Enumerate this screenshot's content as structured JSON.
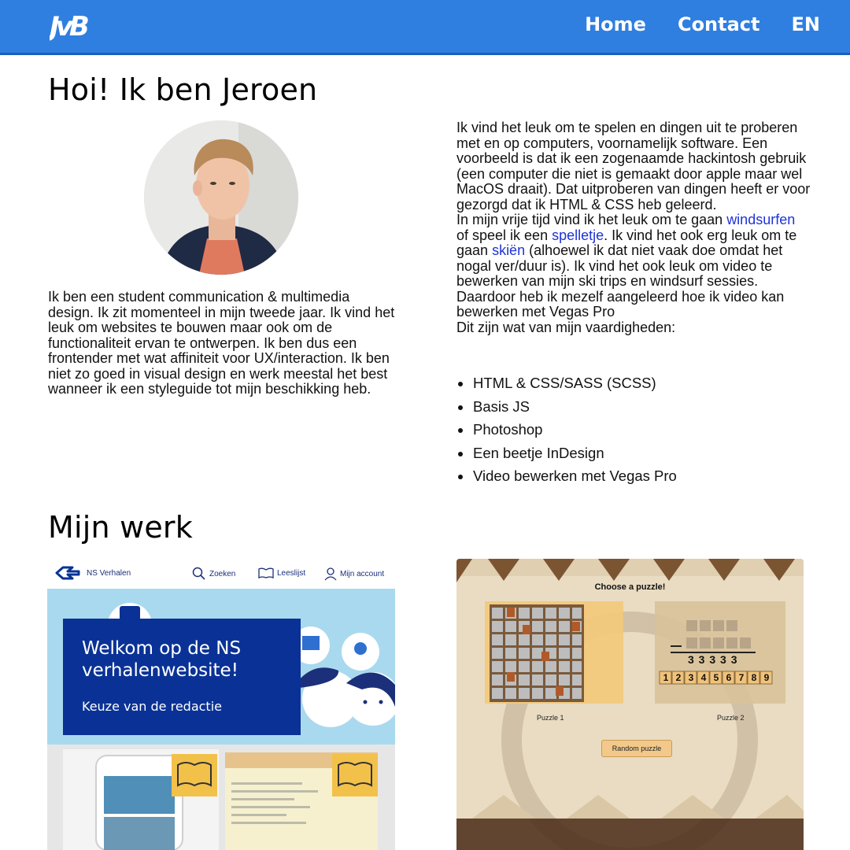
{
  "header": {
    "logo": "JvB",
    "nav": [
      "Home",
      "Contact",
      "EN"
    ]
  },
  "intro": {
    "title": "Hoi! Ik ben Jeroen",
    "left_text": "Ik ben een student communication & multimedia design. Ik zit momenteel in mijn tweede jaar. Ik vind het leuk om websites te bouwen maar ook om de functionaliteit ervan te ontwerpen. Ik ben dus een frontender met wat affiniteit voor UX/interaction. Ik ben niet zo goed in visual design en werk meestal het best wanneer ik een styleguide tot mijn beschikking heb.",
    "right_p1": "Ik vind het leuk om te spelen en dingen uit te proberen met en op computers, voornamelijk software. Een voorbeeld is dat ik een zogenaamde hackintosh gebruik (een computer die niet is gemaakt door apple maar wel MacOS draait). Dat uitproberen van dingen heeft er voor gezorgd dat ik HTML & CSS heb geleerd.",
    "right_p2_a": "In mijn vrije tijd vind ik het leuk om te gaan",
    "link_windsurfen": "windsurfen",
    "right_p2_b": "of speel ik een",
    "link_spelletje": "spelletje",
    "right_p2_c": ". Ik vind het ook erg leuk om te gaan",
    "link_skien": "skiën",
    "right_p2_d": "(alhoewel ik dat niet vaak doe omdat het nogal ver/duur is). Ik vind het ook leuk om video te bewerken van mijn ski trips en windsurf sessies. Daardoor heb ik mezelf aangeleerd hoe ik video kan bewerken met Vegas Pro",
    "skills_intro": "Dit zijn wat van mijn vaardigheden:",
    "skills": [
      "HTML & CSS/SASS (SCSS)",
      "Basis JS",
      "Photoshop",
      "Een beetje InDesign",
      "Video bewerken met Vegas Pro"
    ]
  },
  "work": {
    "title": "Mijn werk",
    "ns": {
      "site_name": "NS Verhalen",
      "menu": [
        "Zoeken",
        "Leeslijst",
        "Mijn account"
      ],
      "hero_title": "Welkom op de NS verhalenwebsite!",
      "hero_sub": "Keuze van de redactie"
    },
    "puzzle": {
      "title": "Choose a puzzle!",
      "labels": [
        "Puzzle 1",
        "Puzzle 2"
      ],
      "button": "Random puzzle",
      "sum_row": "3 3 3 3 3",
      "digits": [
        "1",
        "2",
        "3",
        "4",
        "5",
        "6",
        "7",
        "8",
        "9"
      ]
    }
  },
  "colors": {
    "header": "#2f7fe0",
    "link": "#1e33d6",
    "ns_blue": "#0a3296",
    "ns_sky": "#a9d9ee"
  }
}
